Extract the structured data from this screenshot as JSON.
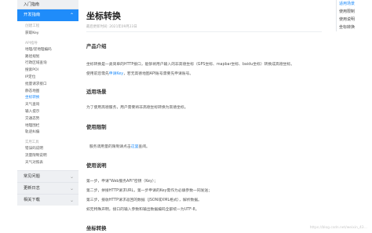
{
  "sidebar": {
    "top": "入门指南",
    "active_section": "开发指南",
    "chevron": "⌃",
    "sub_items": [
      "创建工程",
      "获取Key"
    ],
    "group1": "API指导",
    "group1_items": [
      "地理/逆地理编码",
      "路径规划",
      "行政区域查询",
      "搜索POI",
      "IP定位",
      "批量请求接口",
      "静态地图",
      "坐标转换",
      "天气查询",
      "输入提示",
      "交通态势",
      "地理围栏",
      "轨迹纠偏"
    ],
    "active_item_index": 7,
    "group2": "实用工具",
    "group2_items": [
      "错误码说明",
      "流量限制说明",
      "天气对照表"
    ],
    "bottom_items": [
      "常见问题",
      "更新日志",
      "相关下载"
    ],
    "bottom_chevron": "⌄"
  },
  "main": {
    "title": "坐标转换",
    "meta": "最后更新时间: 2021年09月23日",
    "sec1_title": "产品介绍",
    "sec1_p1": "坐标转换是一类简单的HTTP接口，能够将用户输入的非高德坐标（GPS坐标、mapbar坐标、baidu坐标）转换成高德坐标。",
    "sec1_p2_prefix": "使用前您需先",
    "sec1_p2_link": "申请Key",
    "sec1_p2_suffix": "，若无高德地图API账号需要先申请账号。",
    "sec2_title": "适用场景",
    "sec2_p": "为了使用高德服务，用户需要将非高德坐标转换为高德坐标。",
    "sec3_title": "使用限制",
    "sec3_prefix": "服务调用量的限制请点击",
    "sec3_link": "这里",
    "sec3_suffix": "查阅。",
    "sec4_title": "使用说明",
    "steps": [
      "第一步，申请\"Web服务API\"密钥（Key）；",
      "第二步，拼接HTTP请求URL，第一步申请的Key需作为必填参数一同发送；",
      "第三步，接收HTTP请求返回的数据（JSON或XML格式），解析数据。",
      "如无特殊声明，接口的输入参数和输出数据编码全部统一为UTF-8。"
    ],
    "sec5_title": "坐标转换"
  },
  "toc": {
    "items": [
      "适用场景",
      "使用限制",
      "使用说明",
      "坐标转换"
    ],
    "active_index": 0
  },
  "watermark": "https://blog.csdn.net/weixin_43…"
}
